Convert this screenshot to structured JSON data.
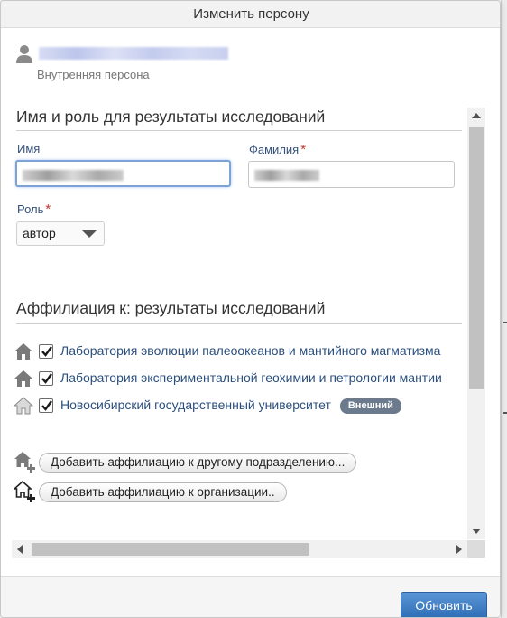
{
  "dialog": {
    "title": "Изменить персону",
    "person_subtitle": "Внутренняя персона"
  },
  "name_section": {
    "heading": "Имя и роль для результаты исследований",
    "first_name_label": "Имя",
    "last_name_label": "Фамилия",
    "role_label": "Роль",
    "required_mark": "*",
    "role_value": "автор"
  },
  "affiliation_section": {
    "heading": "Аффилиация к: результаты исследований",
    "items": [
      {
        "label": "Лаборатория эволюции палеоокеанов и мантийного магматизма",
        "checked": true,
        "icon": "home-icon"
      },
      {
        "label": "Лаборатория экспериментальной геохимии и петрологии мантии",
        "checked": true,
        "icon": "home-icon"
      },
      {
        "label": "Новосибирский государственный университет",
        "checked": true,
        "icon": "home-outline-icon",
        "badge": "Внешний"
      }
    ],
    "add_department_button": "Добавить аффилиацию к другому подразделению...",
    "add_organization_button": "Добавить аффилиацию к организации.."
  },
  "footer": {
    "update_button": "Обновить"
  },
  "colors": {
    "accent": "#2f6db5",
    "label": "#34507a",
    "link": "#2b4f7e",
    "required": "#c0392b",
    "badge": "#6c7a8d"
  }
}
